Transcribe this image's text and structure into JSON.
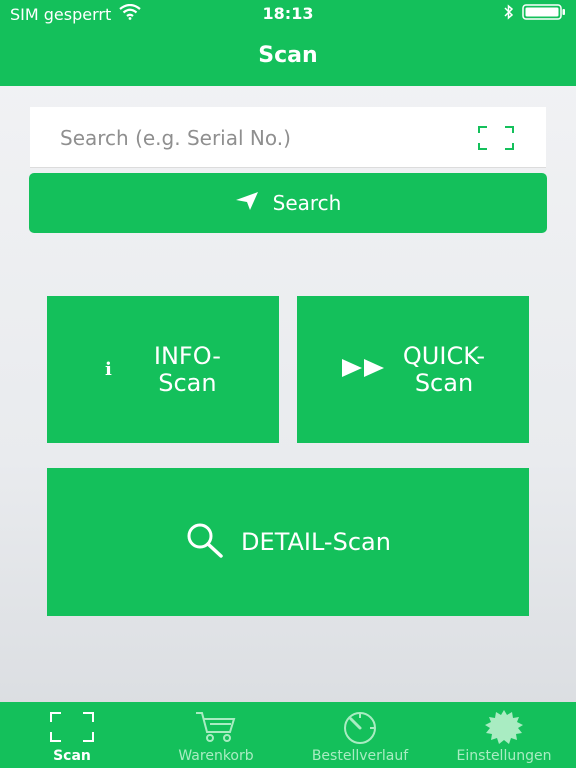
{
  "status_bar": {
    "carrier": "SIM gesperrt",
    "time": "18:13"
  },
  "nav": {
    "title": "Scan"
  },
  "search": {
    "placeholder": "Search (e.g. Serial No.)",
    "value": "",
    "button_label": "Search"
  },
  "tiles": {
    "info_line1": "INFO-",
    "info_line2": "Scan",
    "quick_line1": "QUICK-",
    "quick_line2": "Scan",
    "detail": "DETAIL-Scan"
  },
  "tabs": [
    {
      "label": "Scan",
      "icon": "scan-frame-icon",
      "active": true
    },
    {
      "label": "Warenkorb",
      "icon": "cart-icon",
      "active": false
    },
    {
      "label": "Bestellverlauf",
      "icon": "gauge-icon",
      "active": false
    },
    {
      "label": "Einstellungen",
      "icon": "gear-icon",
      "active": false
    }
  ],
  "colors": {
    "brand_green": "#14c05b",
    "inactive_tab": "#a9ecc2",
    "background": "#eceef0"
  }
}
